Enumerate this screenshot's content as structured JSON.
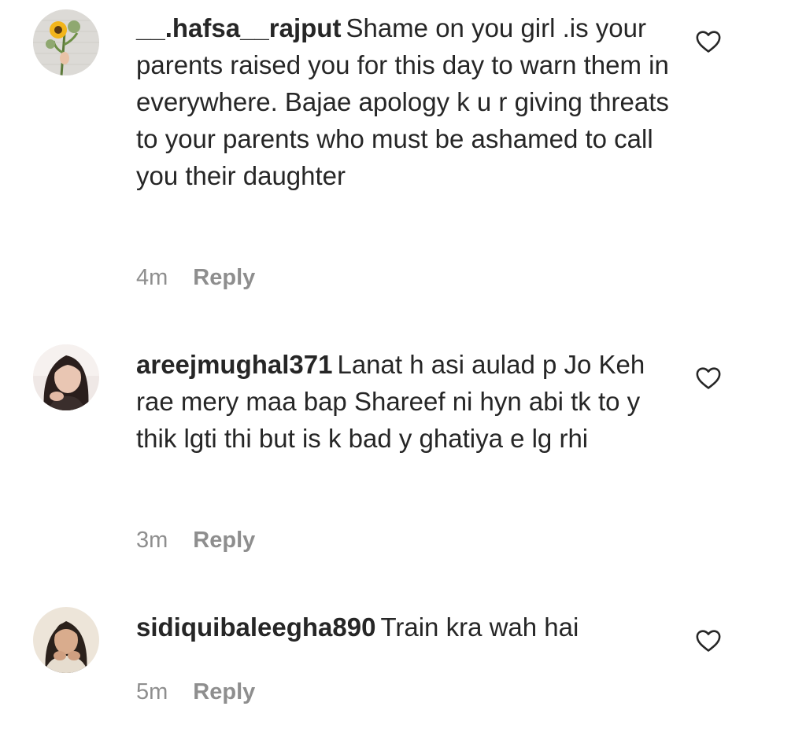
{
  "comments": [
    {
      "username": "__.hafsa__rajput",
      "text": "Shame on you girl .is your parents raised you for this day to warn them in everywhere. Bajae apology k u r giving threats to your parents who must be ashamed to call you their daughter",
      "time": "4m",
      "reply_label": "Reply",
      "avatar_icon": "sunflower-avatar",
      "like_icon": "heart-outline-icon"
    },
    {
      "username": "areejmughal371",
      "text": "Lanat h asi aulad p Jo Keh rae mery maa bap Shareef ni hyn abi tk to y thik lgti thi but is k bad y ghatiya e lg rhi",
      "time": "3m",
      "reply_label": "Reply",
      "avatar_icon": "user-photo-avatar",
      "like_icon": "heart-outline-icon"
    },
    {
      "username": "sidiquibaleegha890",
      "text": "Train kra wah hai",
      "time": "5m",
      "reply_label": "Reply",
      "avatar_icon": "user-photo-avatar",
      "like_icon": "heart-outline-icon"
    }
  ],
  "colors": {
    "text": "#262626",
    "meta": "#8e8e8e",
    "background": "#ffffff"
  }
}
